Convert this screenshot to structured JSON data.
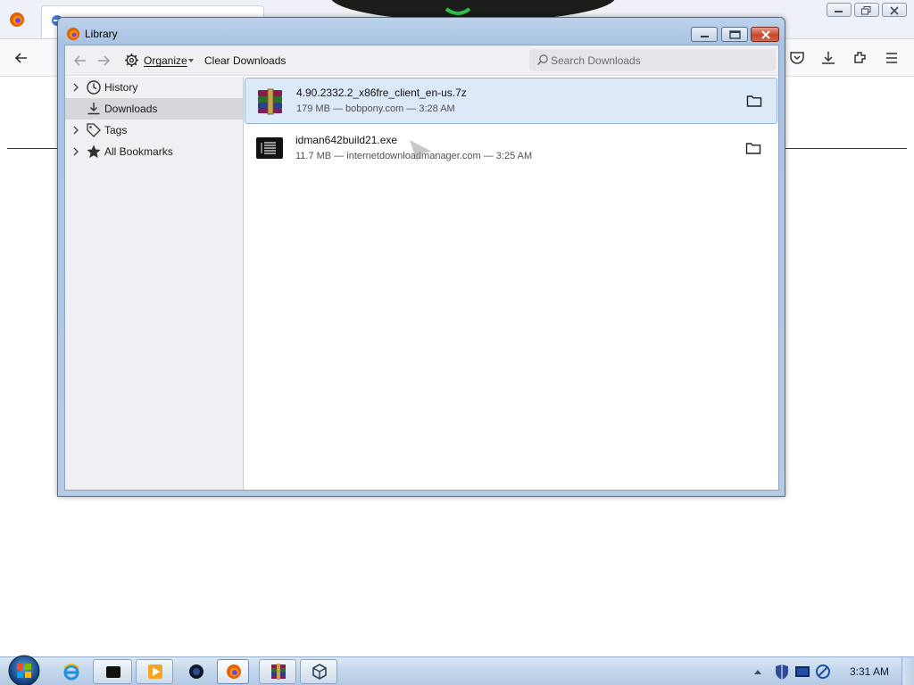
{
  "firefox": {
    "window_controls": [
      "minimize",
      "restore",
      "close"
    ],
    "nav_icons": [
      "back-arrow-icon",
      "pocket-icon",
      "downloads-icon",
      "extensions-icon",
      "menu-icon"
    ]
  },
  "library": {
    "title": "Library",
    "toolbar": {
      "organize_label": "Organize",
      "clear_downloads_label": "Clear Downloads",
      "search_placeholder": "Search Downloads"
    },
    "sidebar": [
      {
        "label": "History",
        "icon": "clock-icon",
        "expandable": true,
        "selected": false
      },
      {
        "label": "Downloads",
        "icon": "download-icon",
        "expandable": false,
        "selected": true
      },
      {
        "label": "Tags",
        "icon": "tag-icon",
        "expandable": true,
        "selected": false
      },
      {
        "label": "All Bookmarks",
        "icon": "star-icon",
        "expandable": true,
        "selected": false
      }
    ],
    "downloads": [
      {
        "name": "4.90.2332.2_x86fre_client_en-us.7z",
        "meta": "179 MB — bobpony.com — 3:28 AM",
        "icon": "winrar-archive-icon",
        "selected": true
      },
      {
        "name": "idman642build21.exe",
        "meta": "11.7 MB — internetdownloadmanager.com — 3:25 AM",
        "icon": "executable-icon",
        "selected": false
      }
    ]
  },
  "taskbar": {
    "clock": "3:31 AM",
    "apps": [
      "internet-explorer-icon",
      "terminal-icon",
      "media-player-icon",
      "app-icon",
      "firefox-icon",
      "winrar-icon",
      "virtualbox-icon"
    ]
  },
  "colors": {
    "accent_selection": "#dce9f8",
    "title_bar": "#bdd3ec",
    "close_button": "#c8452b"
  }
}
